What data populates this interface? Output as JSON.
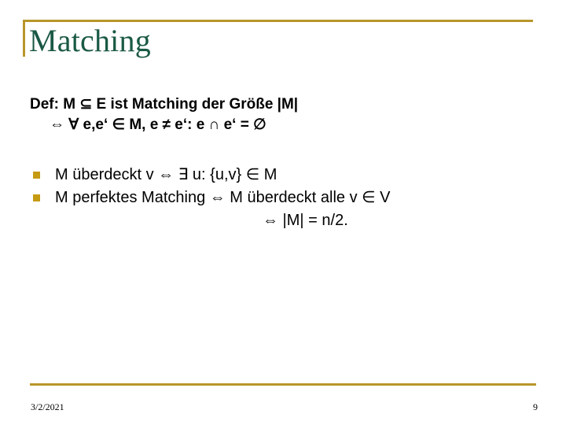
{
  "slide": {
    "title": "Matching",
    "theme": {
      "accent_gold": "#b8962b",
      "bullet_gold": "#c69b14",
      "title_green": "#1a5945",
      "body_black": "#000000",
      "background": "#ffffff"
    },
    "definition": {
      "line1": "Def: M ⊆ E ist Matching der Größe |M|",
      "line2": "⇔ ∀ e,e‘ ∈ M, e ≠ e‘:   e ∩ e‘ = ∅"
    },
    "bullets": [
      {
        "text": "M überdeckt v ⇔ ∃ u: {u,v} ∈ M"
      },
      {
        "text": "M perfektes Matching  ⇔ M überdeckt alle v ∈ V"
      }
    ],
    "continuation": "⇔ |M| = n/2.",
    "footer": {
      "date": "3/2/2021",
      "page_number": "9"
    }
  }
}
